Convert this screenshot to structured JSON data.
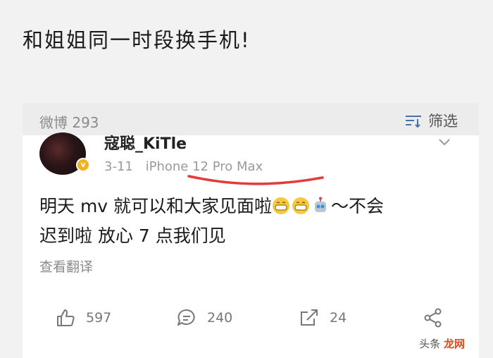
{
  "caption": "和姐姐同一时段换手机!",
  "filter_bar": {
    "repost_label": "微博 293",
    "filter_label": "筛选"
  },
  "post": {
    "username": "寇聪_KiTle",
    "date": "3-11",
    "device": "iPhone 12 Pro Max",
    "text_line1": "明天 mv 就可以和大家见面啦",
    "text_line1_tail": "～不会",
    "text_line2": "迟到啦 放心 7 点我们见",
    "translate_label": "查看翻译"
  },
  "actions": {
    "likes": "597",
    "comments": "240",
    "reposts": "24"
  },
  "watermark": {
    "prefix": "头条",
    "brand": "龙网"
  },
  "colors": {
    "underline": "#e33a3a",
    "badge": "#f2b01e"
  }
}
